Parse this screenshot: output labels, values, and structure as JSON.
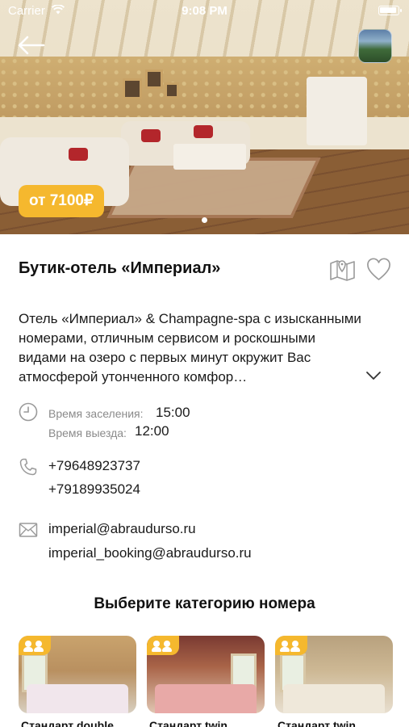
{
  "status_bar": {
    "carrier": "Carrier",
    "time": "9:08 PM"
  },
  "hero": {
    "price": "от 7100₽",
    "accent_color": "#F5B82E"
  },
  "hotel": {
    "title": "Бутик-отель «Империал»",
    "description": "Отель «Империал» & Champagne-spa с изысканными номерами, отличным сервисом и роскошными видами на озеро с первых минут окружит Вас атмосферой утонченного комфор…",
    "check_in_label": "Время заселения:",
    "check_in_time": "15:00",
    "check_out_label": "Время выезда:",
    "check_out_time": "12:00",
    "phones": [
      "+79648923737",
      "+79189935024"
    ],
    "emails": [
      "imperial@abraudurso.ru",
      "imperial_booking@abraudurso.ru"
    ]
  },
  "rooms_section": {
    "title": "Выберите категорию номера",
    "rooms": [
      {
        "name": "Стандарт double"
      },
      {
        "name": "Стандарт twin"
      },
      {
        "name": "Стандарт twin"
      }
    ]
  },
  "icons": [
    "back-arrow-icon",
    "map-icon",
    "heart-icon",
    "chevron-down-icon",
    "clock-icon",
    "phone-icon",
    "mail-icon",
    "people-icon",
    "wifi-icon",
    "battery-icon"
  ]
}
